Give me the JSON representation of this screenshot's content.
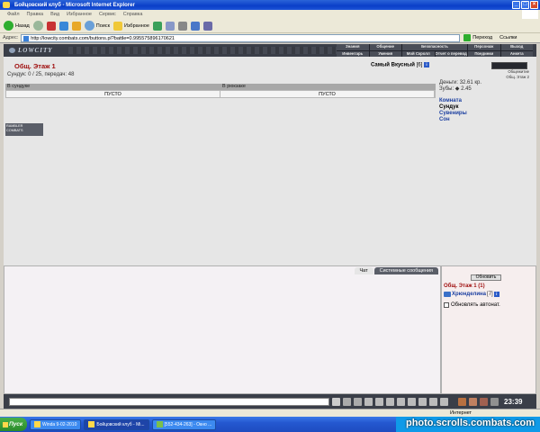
{
  "window": {
    "title": "Бойцовский клуб - Microsoft Internet Explorer"
  },
  "menu": [
    "Файл",
    "Правка",
    "Вид",
    "Избранное",
    "Сервис",
    "Справка"
  ],
  "toolbar": {
    "back": "Назад",
    "search": "Поиск",
    "favorites": "Избранное"
  },
  "address": {
    "label": "Адрес:",
    "url": "http://lowcity.combats.com/buttons.pl?battle=0.995575896170621",
    "go": "Переход",
    "links": "Ссылки"
  },
  "banner": {
    "logo": "LOWCITY",
    "nav": [
      "Знания",
      "Общение",
      "Безопасность",
      "Персонаж",
      "Выход",
      "Инвентарь",
      "Умения",
      "Мой Скролл",
      "Отчет о переводах",
      "Поединки",
      "Анкета"
    ]
  },
  "location": {
    "title": "Общ. Этаж 1",
    "chest_info": "Сундук: 0 / 25, передач: 48"
  },
  "player": {
    "name": "Самый Вкусный",
    "level": "[6]"
  },
  "storage": {
    "headers": [
      "В сундуке",
      "В рюкзаке"
    ],
    "cells": [
      "ПУСТО",
      "ПУСТО"
    ]
  },
  "wallet": {
    "money": "Деньги: 32.61 кр.",
    "teeth_label": "Зубы:",
    "teeth_value": "2.45"
  },
  "side_links": [
    "Комната",
    "Сундук",
    "Сувениры",
    "Сон"
  ],
  "minimap": {
    "items": [
      "Общежитие",
      "Общ. Этаж 2"
    ]
  },
  "counter": {
    "lines": [
      "RAMBLER",
      "COMBATS"
    ]
  },
  "chat": {
    "tabs": [
      "Чат",
      "Системные сообщения"
    ]
  },
  "userlist": {
    "refresh": "Обновить",
    "room": "Общ. Этаж 1 (1)",
    "user": "Хрюнделина",
    "user_level": "[7]",
    "auto": "Обновлять автонат."
  },
  "clock": "23:39",
  "status": {
    "zone": "Интернет"
  },
  "taskbar": {
    "start": "Пуск",
    "tasks": [
      "Winda 9-02-2010",
      "Бойцовский клуб - Mi...",
      "[552-434-263] - Окно ..."
    ]
  },
  "watermark": "photo.scrolls.combats.com"
}
